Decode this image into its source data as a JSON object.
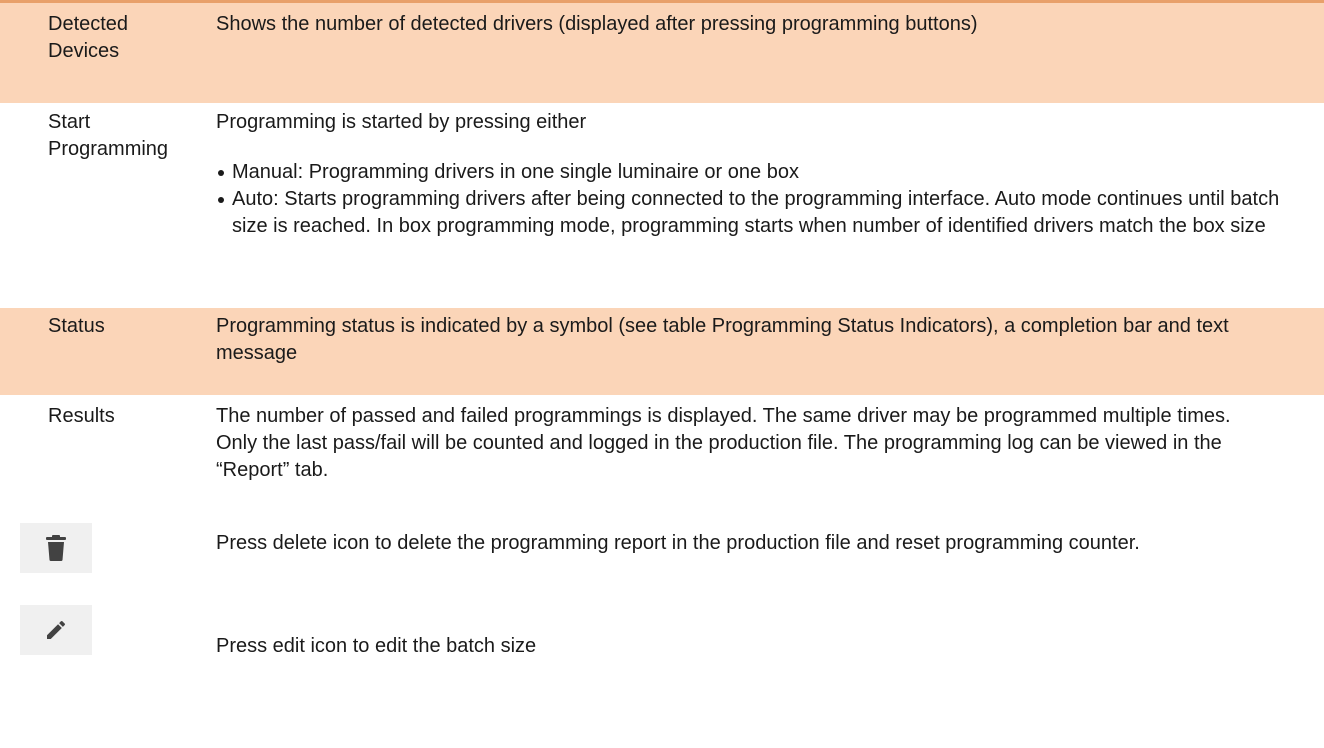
{
  "rows": [
    {
      "term": "Detected Devices",
      "description": "Shows the number of detected drivers (displayed after pressing programming buttons)"
    },
    {
      "term": "Start Programming",
      "description": "Programming is started by pressing either",
      "bullets": [
        "Manual: Programming drivers in one single luminaire or one box",
        "Auto: Starts programming drivers after being connected to the programming interface. Auto mode continues until batch size is reached. In box programming mode, programming starts when number of identified drivers match the box size"
      ]
    },
    {
      "term": "Status",
      "description": "Programming status is indicated by a symbol (see table Programming Status Indicators), a completion bar and text message"
    },
    {
      "term": "Results",
      "description": "The number of passed and failed programmings is displayed. The same driver may be programmed multiple times. Only the last pass/fail will be counted and logged in the production file. The programming log can be viewed in the “Report” tab."
    },
    {
      "icon": "delete-icon",
      "description": "Press delete icon to delete the programming report in the production file and reset programming counter."
    },
    {
      "icon": "edit-icon",
      "description": "Press edit icon to edit the batch size"
    }
  ],
  "colors": {
    "shaded_row": "#fbd5b8",
    "top_rule": "#e8a06a",
    "icon_background": "#f0f0f0",
    "icon_color": "#424242"
  }
}
